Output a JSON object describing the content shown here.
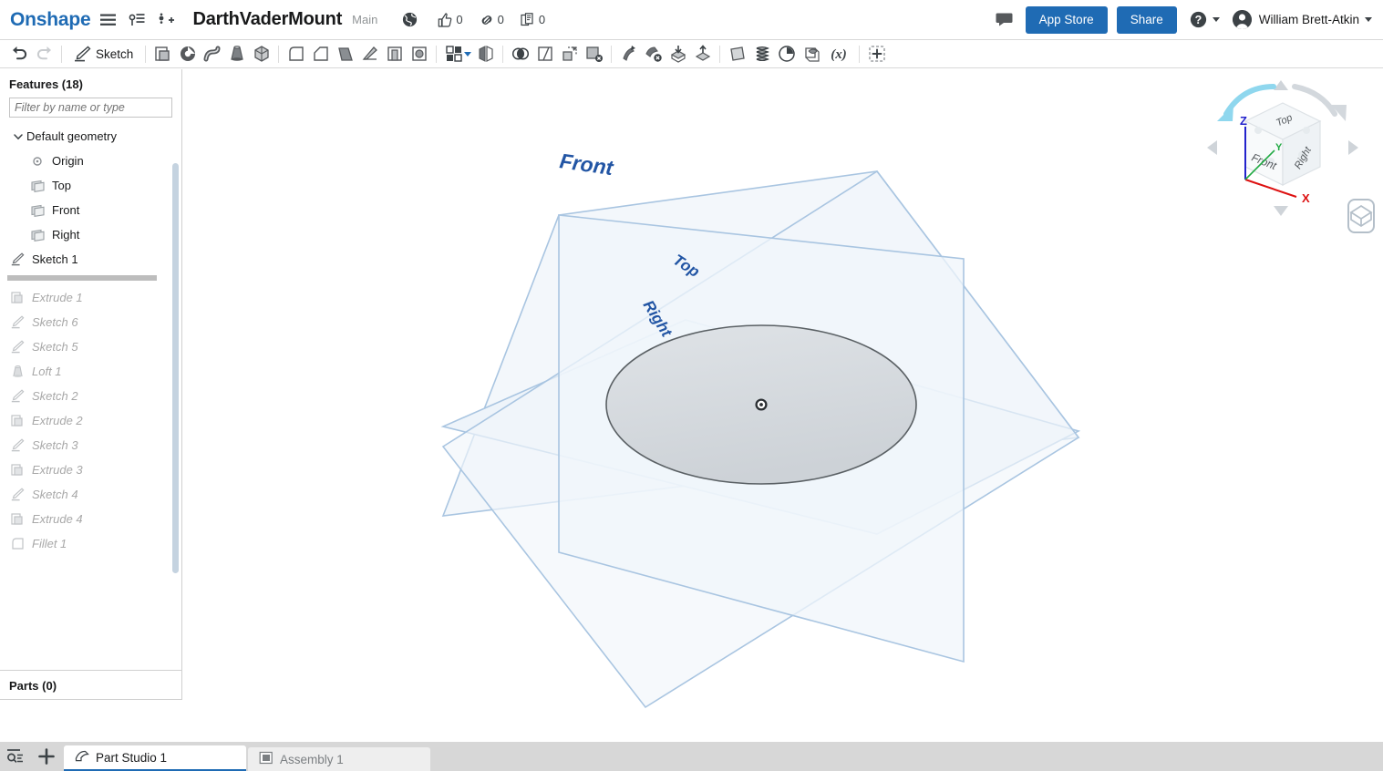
{
  "header": {
    "brand": "Onshape",
    "menu_icon": "hamburger-icon",
    "versions_icon": "version-branch-icon",
    "insert_icon": "insert-node-icon",
    "document_title": "DarthVaderMount",
    "branch_label": "Main",
    "public_icon": "globe-icon",
    "stats": [
      {
        "icon": "thumbs-up-icon",
        "name": "likes",
        "value": "0"
      },
      {
        "icon": "link-icon",
        "name": "links",
        "value": "0"
      },
      {
        "icon": "copy-icon",
        "name": "copies",
        "value": "0"
      }
    ],
    "comments_icon": "comment-bubble-icon",
    "app_store_label": "App Store",
    "share_label": "Share",
    "help_icon": "help-circle-icon",
    "user_name": "William Brett-Atkin",
    "accent_color": "#1f6bb4"
  },
  "toolbar": {
    "undo_label": "Undo",
    "redo_label": "Redo",
    "sketch_label": "Sketch",
    "items": [
      {
        "name": "extrude-tool",
        "icon": "extrude-icon"
      },
      {
        "name": "revolve-tool",
        "icon": "revolve-icon"
      },
      {
        "name": "sweep-tool",
        "icon": "sweep-icon"
      },
      {
        "name": "loft-tool",
        "icon": "loft-icon"
      },
      {
        "name": "thicken-tool",
        "icon": "thicken-icon"
      },
      {
        "name": "fillet-tool",
        "icon": "fillet-icon"
      },
      {
        "name": "chamfer-tool",
        "icon": "chamfer-icon"
      },
      {
        "name": "draft-tool",
        "icon": "draft-icon"
      },
      {
        "name": "rib-tool",
        "icon": "rib-icon"
      },
      {
        "name": "shell-tool",
        "icon": "shell-icon"
      },
      {
        "name": "hole-tool",
        "icon": "hole-icon"
      },
      {
        "name": "pattern-tool",
        "icon": "pattern-grid-icon"
      },
      {
        "name": "mirror-tool",
        "icon": "mirror-icon"
      },
      {
        "name": "boolean-tool",
        "icon": "boolean-icon"
      },
      {
        "name": "split-tool",
        "icon": "split-icon"
      },
      {
        "name": "move-face-tool",
        "icon": "move-face-icon"
      },
      {
        "name": "delete-face-tool",
        "icon": "delete-face-icon"
      },
      {
        "name": "transform-tool",
        "icon": "transform-icon"
      },
      {
        "name": "delete-part-tool",
        "icon": "delete-part-icon"
      },
      {
        "name": "import-derived-tool",
        "icon": "import-derived-icon"
      },
      {
        "name": "export-tool",
        "icon": "export-icon"
      },
      {
        "name": "plane-tool",
        "icon": "plane-icon"
      },
      {
        "name": "helix-tool",
        "icon": "helix-icon"
      },
      {
        "name": "curve-tool",
        "icon": "curve-clock-icon"
      },
      {
        "name": "composite-part-tool",
        "icon": "composite-part-icon"
      },
      {
        "name": "variable-tool",
        "icon": "variable-x-icon"
      },
      {
        "name": "custom-feature-tool",
        "icon": "add-dashed-icon"
      }
    ]
  },
  "sidebar": {
    "features_title": "Features (18)",
    "filter_placeholder": "Filter by name or type",
    "default_geometry": {
      "label": "Default geometry",
      "children": [
        {
          "label": "Origin",
          "icon": "origin-icon"
        },
        {
          "label": "Top",
          "icon": "plane-icon"
        },
        {
          "label": "Front",
          "icon": "plane-icon"
        },
        {
          "label": "Right",
          "icon": "plane-icon"
        }
      ]
    },
    "active_features": [
      {
        "label": "Sketch 1",
        "icon": "sketch-icon"
      }
    ],
    "rolled_back_features": [
      {
        "label": "Extrude 1",
        "icon": "extrude-icon"
      },
      {
        "label": "Sketch 6",
        "icon": "sketch-icon"
      },
      {
        "label": "Sketch 5",
        "icon": "sketch-icon"
      },
      {
        "label": "Loft 1",
        "icon": "loft-icon"
      },
      {
        "label": "Sketch 2",
        "icon": "sketch-icon"
      },
      {
        "label": "Extrude 2",
        "icon": "extrude-icon"
      },
      {
        "label": "Sketch 3",
        "icon": "sketch-icon"
      },
      {
        "label": "Extrude 3",
        "icon": "extrude-icon"
      },
      {
        "label": "Sketch 4",
        "icon": "sketch-icon"
      },
      {
        "label": "Extrude 4",
        "icon": "extrude-icon"
      },
      {
        "label": "Fillet 1",
        "icon": "fillet-icon"
      }
    ],
    "parts_title": "Parts (0)"
  },
  "viewport": {
    "planes": [
      {
        "name": "front-plane",
        "label": "Front"
      },
      {
        "name": "top-plane",
        "label": "Top"
      },
      {
        "name": "right-plane",
        "label": "Right"
      }
    ],
    "origin_marker": "origin-point",
    "sketch_entity": "ellipse-circle",
    "plane_label_color": "#2255a4",
    "plane_fill": "#f2f6fb",
    "plane_stroke": "#a8c4e0",
    "sketch_fill": "#d5dae0",
    "sketch_stroke": "#5a5f63",
    "view_cube": {
      "faces": {
        "top": "Top",
        "front": "Front",
        "right": "Right"
      },
      "axes": [
        {
          "label": "Z",
          "color": "#2222cc"
        },
        {
          "label": "Y",
          "color": "#22aa44"
        },
        {
          "label": "X",
          "color": "#dd1111"
        }
      ],
      "rotate_arrow": "rotate-ccw-arrow",
      "nav_arrows": [
        "nav-arrow-up",
        "nav-arrow-down",
        "nav-arrow-left",
        "nav-arrow-right"
      ]
    },
    "display_mode_icon": "display-cube-icon"
  },
  "tabbar": {
    "search_icon": "search-list-icon",
    "add_icon": "plus-icon",
    "tabs": [
      {
        "label": "Part Studio 1",
        "icon": "part-studio-icon",
        "active": true
      },
      {
        "label": "Assembly 1",
        "icon": "assembly-icon",
        "active": false
      }
    ]
  }
}
